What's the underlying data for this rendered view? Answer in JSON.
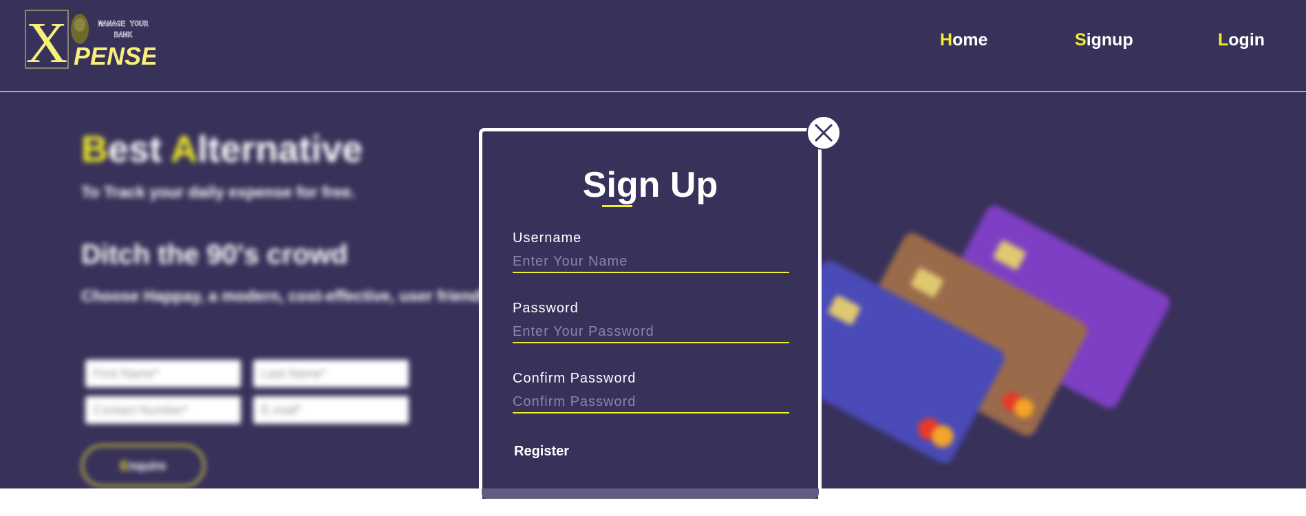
{
  "header": {
    "logo": {
      "letter": "X",
      "tagline_1": "MANAGE YOUR",
      "tagline_2": "BANK",
      "word": "PENSE"
    },
    "nav": [
      {
        "first": "H",
        "rest": "ome"
      },
      {
        "first": "S",
        "rest": "ignup"
      },
      {
        "first": "L",
        "rest": "ogin"
      }
    ]
  },
  "hero": {
    "title_b": "B",
    "title_rest1": "est ",
    "title_a": "A",
    "title_rest2": "lternative",
    "subtitle": "To Track your daily expense for free.",
    "heading": "Ditch the 90's crowd",
    "description": "Choose Happay, a modern, cost-effective, user friendly expense management.",
    "fields": {
      "first_name": "First Name*",
      "last_name": "Last Name*",
      "contact": "Contact Number*",
      "email": "E-mail*"
    },
    "enquire_first": "E",
    "enquire_rest": "nquire"
  },
  "modal": {
    "title": "Sign Up",
    "username_label": "Username",
    "username_placeholder": "Enter Your Name",
    "password_label": "Password",
    "password_placeholder": "Enter Your Password",
    "confirm_label": "Confirm Password",
    "confirm_placeholder": "Confirm Password",
    "register_label": "Register"
  },
  "colors": {
    "background": "#38315a",
    "accent": "#f3ee29",
    "text": "#ffffff"
  }
}
